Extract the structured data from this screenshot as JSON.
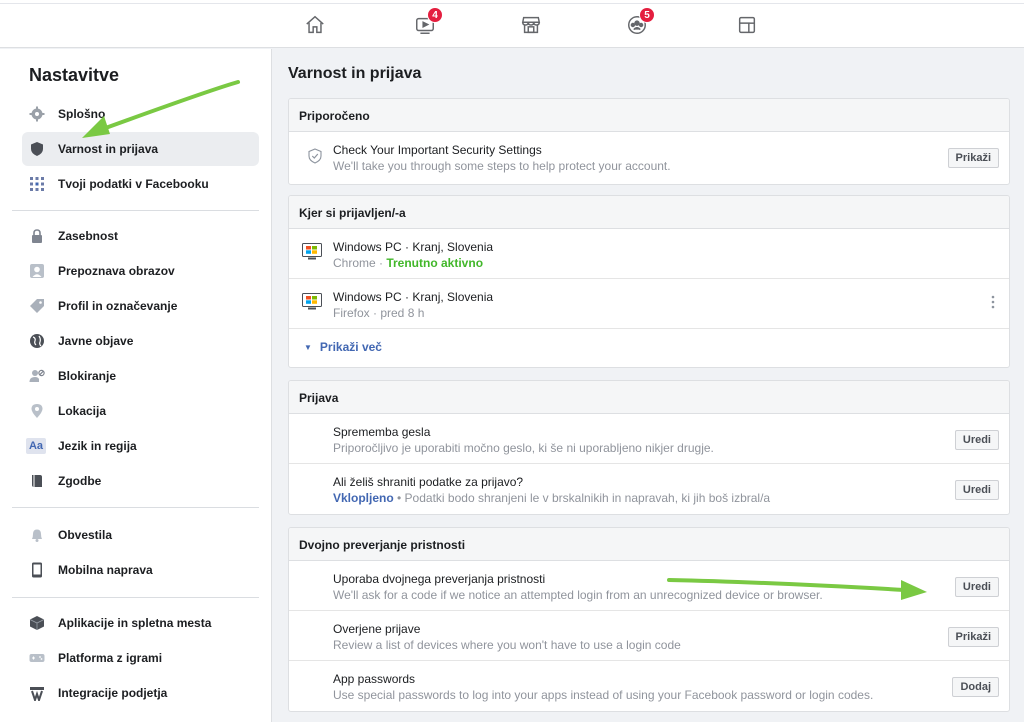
{
  "topnav": {
    "icons": [
      {
        "name": "home-icon"
      },
      {
        "name": "watch-icon",
        "badge": "4"
      },
      {
        "name": "marketplace-icon"
      },
      {
        "name": "groups-icon",
        "badge": "5"
      },
      {
        "name": "gaming-icon"
      }
    ]
  },
  "sidebar": {
    "title": "Nastavitve",
    "items": [
      {
        "label": "Splošno",
        "icon": "gear-icon"
      },
      {
        "label": "Varnost in prijava",
        "icon": "shield-icon",
        "active": true
      },
      {
        "label": "Tvoji podatki v Facebooku",
        "icon": "grid-icon"
      },
      {
        "label": "Zasebnost",
        "icon": "lock-icon"
      },
      {
        "label": "Prepoznava obrazov",
        "icon": "face-icon"
      },
      {
        "label": "Profil in označevanje",
        "icon": "tag-icon"
      },
      {
        "label": "Javne objave",
        "icon": "globe-icon"
      },
      {
        "label": "Blokiranje",
        "icon": "block-user-icon"
      },
      {
        "label": "Lokacija",
        "icon": "location-pin-icon"
      },
      {
        "label": "Jezik in regija",
        "icon": "language-icon"
      },
      {
        "label": "Zgodbe",
        "icon": "book-icon"
      },
      {
        "label": "Obvestila",
        "icon": "bell-icon"
      },
      {
        "label": "Mobilna naprava",
        "icon": "phone-icon"
      },
      {
        "label": "Aplikacije in spletna mesta",
        "icon": "cube-icon"
      },
      {
        "label": "Platforma z igrami",
        "icon": "gamepad-icon"
      },
      {
        "label": "Integracije podjetja",
        "icon": "integrations-icon"
      }
    ]
  },
  "main": {
    "title": "Varnost in prijava",
    "recommended": {
      "header": "Priporočeno",
      "title": "Check Your Important Security Settings",
      "desc": "We'll take you through some steps to help protect your account.",
      "button": "Prikaži"
    },
    "sessions": {
      "header": "Kjer si prijavljen/-a",
      "items": [
        {
          "device": "Windows PC · Kranj, Slovenia",
          "browser": "Chrome · ",
          "status": "Trenutno aktivno"
        },
        {
          "device": "Windows PC · Kranj, Slovenia",
          "browser": "Firefox · pred 8 h",
          "status": ""
        }
      ],
      "show_more": "Prikaži več"
    },
    "login": {
      "header": "Prijava",
      "rows": [
        {
          "title": "Sprememba gesla",
          "desc": "Priporočljivo je uporabiti močno geslo, ki še ni uporabljeno nikjer drugje.",
          "button": "Uredi"
        },
        {
          "title": "Ali želiš shraniti podatke za prijavo?",
          "desc_on": "Vklopljeno",
          "desc": " • Podatki bodo shranjeni le v brskalnikih in napravah, ki jih boš izbral/a",
          "button": "Uredi"
        }
      ]
    },
    "twofactor": {
      "header": "Dvojno preverjanje pristnosti",
      "rows": [
        {
          "title": "Uporaba dvojnega preverjanja pristnosti",
          "desc": "We'll ask for a code if we notice an attempted login from an unrecognized device or browser.",
          "button": "Uredi"
        },
        {
          "title": "Overjene prijave",
          "desc": "Review a list of devices where you won't have to use a login code",
          "button": "Prikaži"
        },
        {
          "title": "App passwords",
          "desc": "Use special passwords to log into your apps instead of using your Facebook password or login codes.",
          "button": "Dodaj"
        }
      ]
    }
  },
  "colors": {
    "accent": "#4267b2",
    "active_green": "#42b72a",
    "badge": "#e41e3f",
    "annotation_arrow": "#7ac943"
  }
}
